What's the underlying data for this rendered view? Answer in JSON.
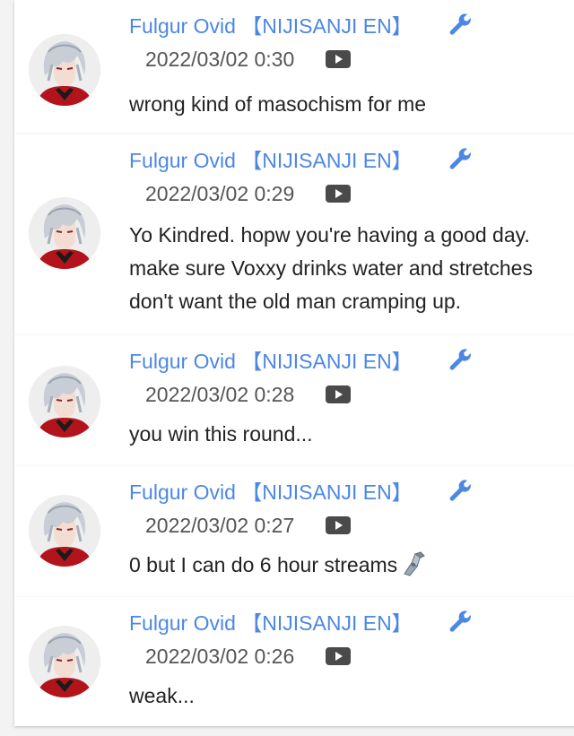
{
  "comments": [
    {
      "author": "Fulgur Ovid 【NIJISANJI EN】",
      "timestamp": "2022/03/02 0:30",
      "lines": [
        "wrong kind of masochism for me"
      ],
      "emoji": ""
    },
    {
      "author": "Fulgur Ovid 【NIJISANJI EN】",
      "timestamp": "2022/03/02 0:29",
      "lines": [
        "Yo Kindred. hopw you're having a good day.",
        "make sure Voxxy drinks water and stretches",
        "don't want the old man cramping up."
      ],
      "emoji": ""
    },
    {
      "author": "Fulgur Ovid 【NIJISANJI EN】",
      "timestamp": "2022/03/02 0:28",
      "lines": [
        "you win this round..."
      ],
      "emoji": ""
    },
    {
      "author": "Fulgur Ovid 【NIJISANJI EN】",
      "timestamp": "2022/03/02 0:27",
      "lines": [
        "0 but I can do 6 hour streams"
      ],
      "emoji": "mechanical-arm-icon"
    },
    {
      "author": "Fulgur Ovid 【NIJISANJI EN】",
      "timestamp": "2022/03/02 0:26",
      "lines": [
        "weak..."
      ],
      "emoji": ""
    }
  ],
  "icons": {
    "moderator": "wrench-icon",
    "source": "youtube-icon"
  },
  "colors": {
    "author": "#4c87e4",
    "timestamp": "#555555",
    "message": "#222222",
    "card_bg": "#ffffff",
    "page_bg": "#f3f3f4"
  }
}
